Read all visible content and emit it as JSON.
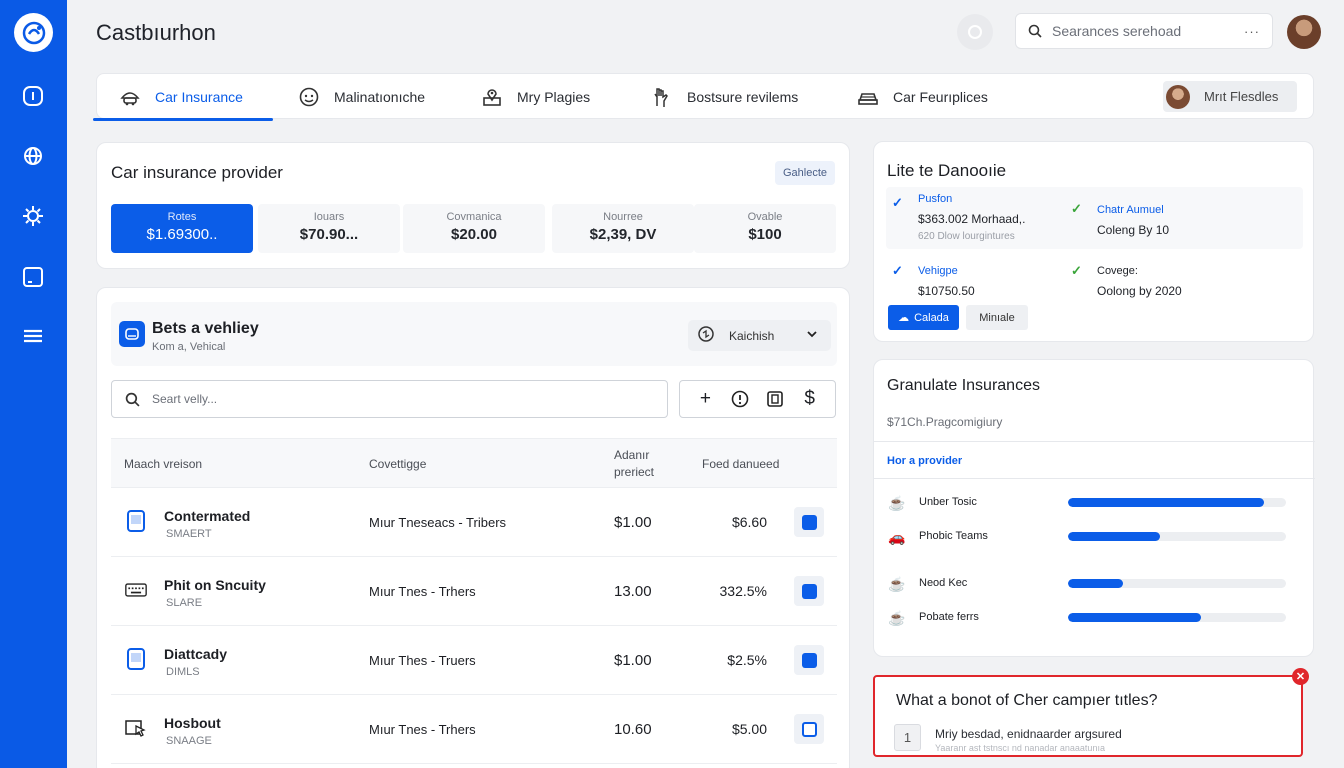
{
  "app": {
    "title": "Castbıurhon"
  },
  "header": {
    "search_placeholder": "Searances serehoad",
    "search_more": "···"
  },
  "tabs": [
    {
      "label": "Car Insurance",
      "icon": "car-umbrella-icon",
      "active": true
    },
    {
      "label": "Malinatıonıche",
      "icon": "face-icon"
    },
    {
      "label": "Mry Plagies",
      "icon": "map-pin-icon"
    },
    {
      "label": "Bostsure revilems",
      "icon": "hand-icon"
    },
    {
      "label": "Car Feurıplices",
      "icon": "car-icon"
    }
  ],
  "tab_user": {
    "label": "Mrıt Flesdles"
  },
  "provider": {
    "title": "Car insurance provider",
    "badge": "Gahlecte",
    "stats": [
      {
        "label": "Rotes",
        "value": "$1.69300..",
        "active": true
      },
      {
        "label": "Iouars",
        "value": "$70.90..."
      },
      {
        "label": "Covmanica",
        "value": "$20.00"
      },
      {
        "label": "Nourree",
        "value": "$2,39, DV"
      },
      {
        "label": "Ovable",
        "value": "$100"
      }
    ]
  },
  "vehicles": {
    "title": "Bets a vehliey",
    "subtitle": "Kom a, Vehical",
    "select_label": "Kaichish",
    "search_placeholder": "Seart velly...",
    "tools": [
      "+",
      "!",
      "⧉",
      "$"
    ],
    "columns": {
      "machine": "Maach vreison",
      "coverage": "Covettigge",
      "premium_line1": "Adanır",
      "premium_line2": "preriect",
      "fee": "Foed danueed"
    },
    "rows": [
      {
        "name": "Contermated",
        "sub": "SMAERT",
        "coverage": "Mıur Tneseacs - Tribers",
        "premium": "$1.00",
        "fee": "$6.60",
        "checked": true,
        "icon": "phone-icon"
      },
      {
        "name": "Phit on Sncuity",
        "sub": "SLARE",
        "coverage": "Mıur Tnes - Trhers",
        "premium": "13.00",
        "fee": "332.5%",
        "checked": true,
        "icon": "keyboard-icon"
      },
      {
        "name": "Diattcady",
        "sub": "DIMLS",
        "coverage": "Mıur Thes - Truers",
        "premium": "$1.00",
        "fee": "$2.5%",
        "checked": true,
        "icon": "tablet-icon"
      },
      {
        "name": "Hosbout",
        "sub": "SNAAGE",
        "coverage": "Mıur Tnes - Trhers",
        "premium": "10.60",
        "fee": "$5.00",
        "checked": false,
        "icon": "cursor-icon"
      }
    ]
  },
  "details": {
    "title": "Lite te Danooıie",
    "items": [
      {
        "key": "Pusfon",
        "value": "$363.002 Morhaad,.",
        "sub": "620 Dlow lourgintures"
      },
      {
        "key": "Chatr Aumuel",
        "value": "Coleng By 10"
      },
      {
        "key": "Vehigpe",
        "value": "$10750.50"
      },
      {
        "key": "Covege:",
        "value": "Oolong by 2020"
      }
    ],
    "primary_button": "Calada",
    "secondary_button": "Minıale"
  },
  "compare": {
    "title": "Granulate Insurances",
    "subtitle": "$71Ch.Pragcomigiury",
    "link": "Hor a provider",
    "providers": [
      {
        "label": "Unber Tosic",
        "value": 0.9,
        "icon": "teapot-icon"
      },
      {
        "label": "Phobic Teams",
        "value": 0.42,
        "icon": "car-icon"
      },
      {
        "label": "Neod Kec",
        "value": 0.25,
        "icon": "teapot-icon"
      },
      {
        "label": "Pobate ferrs",
        "value": 0.61,
        "icon": "teapot-icon"
      }
    ]
  },
  "question": {
    "text": "What a bonot of Cher campıer tıtles?",
    "number": "1",
    "answer": "Mriy besdad, enidnaarder argsured",
    "answer_hint": "Yaaranr ast tstnscı nd nanadar anaaatunıa"
  },
  "colors": {
    "primary": "#0b5de8",
    "sidebar": "#0a5ae6",
    "danger": "#e0262b",
    "check_green": "#3aa53a"
  }
}
